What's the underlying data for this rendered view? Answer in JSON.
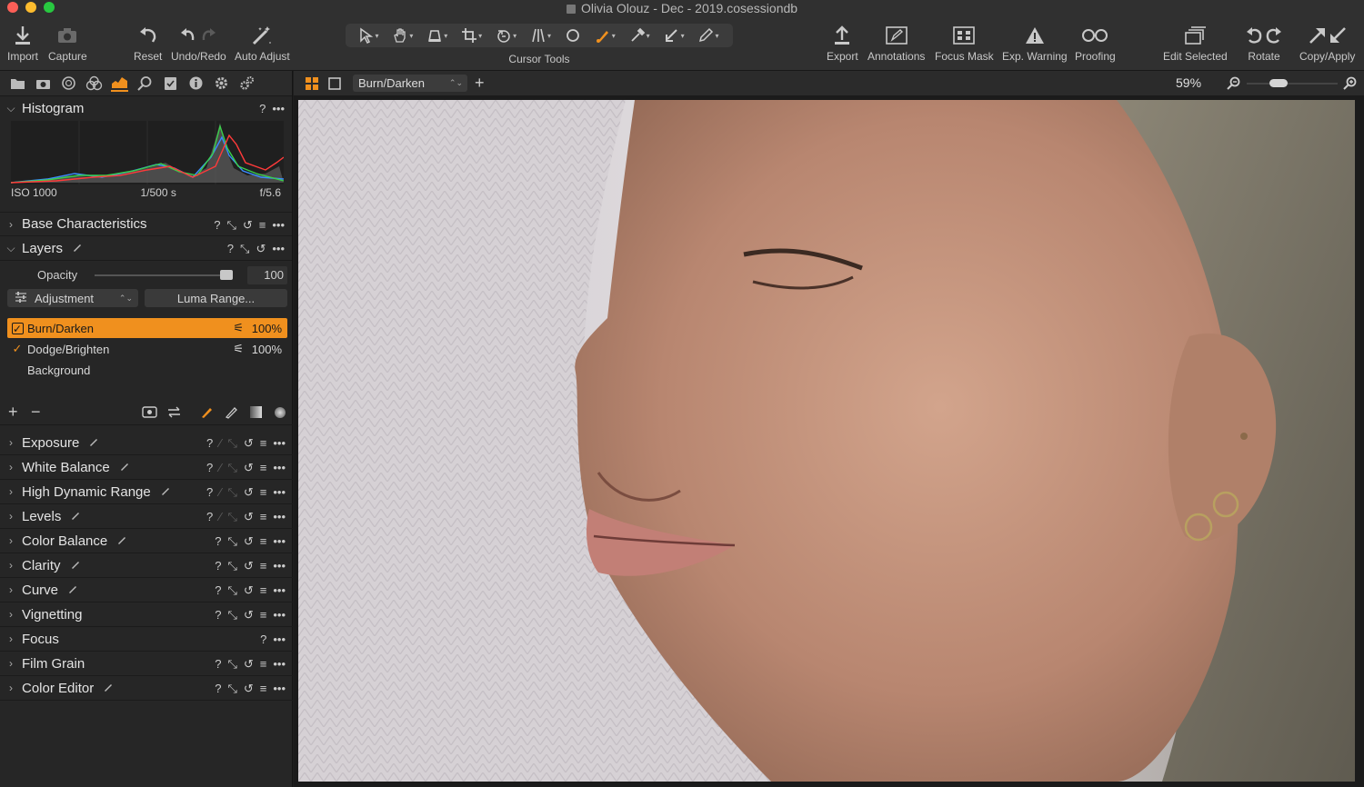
{
  "window": {
    "title": "Olivia Olouz - Dec - 2019.cosessiondb",
    "traffic_colors": [
      "#fc5f57",
      "#fdbc2e",
      "#28c840"
    ]
  },
  "toolbar": {
    "import": "Import",
    "capture": "Capture",
    "reset": "Reset",
    "undo_redo": "Undo/Redo",
    "auto_adjust": "Auto Adjust",
    "cursor_tools": "Cursor Tools",
    "export": "Export",
    "annotations": "Annotations",
    "focus_mask": "Focus Mask",
    "exp_warning": "Exp. Warning",
    "proofing": "Proofing",
    "edit_selected": "Edit Selected",
    "rotate": "Rotate",
    "copy_apply": "Copy/Apply"
  },
  "histogram": {
    "title": "Histogram",
    "iso": "ISO 1000",
    "shutter": "1/500 s",
    "aperture": "f/5.6"
  },
  "sections": {
    "base_characteristics": "Base Characteristics",
    "layers": "Layers"
  },
  "layers": {
    "opacity_label": "Opacity",
    "opacity_value": "100",
    "opacity_level": 1.0,
    "adjustment_label": "Adjustment",
    "luma_range_label": "Luma Range...",
    "items": [
      {
        "name": "Burn/Darken",
        "checked": "✓",
        "pct": "100%"
      },
      {
        "name": "Dodge/Brighten",
        "checked": "✓",
        "pct": "100%"
      },
      {
        "name": "Background",
        "checked": "",
        "pct": ""
      }
    ]
  },
  "tools": [
    {
      "label": "Exposure"
    },
    {
      "label": "White Balance"
    },
    {
      "label": "High Dynamic Range"
    },
    {
      "label": "Levels"
    },
    {
      "label": "Color Balance"
    },
    {
      "label": "Clarity"
    },
    {
      "label": "Curve"
    },
    {
      "label": "Vignetting"
    },
    {
      "label": "Focus"
    },
    {
      "label": "Film Grain"
    },
    {
      "label": "Color Editor"
    }
  ],
  "viewer": {
    "layer_select": "Burn/Darken",
    "zoom": "59%",
    "zoom_level": 0.35
  },
  "colors": {
    "accent": "#f0901e",
    "panel": "#262626",
    "toolbar": "#303030"
  }
}
